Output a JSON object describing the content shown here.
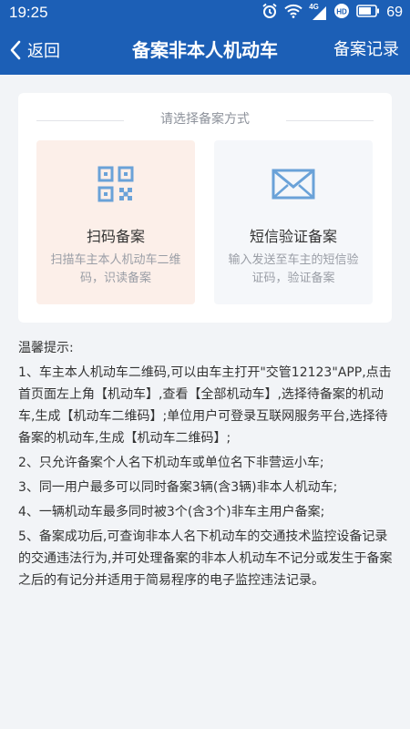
{
  "status": {
    "time": "19:25",
    "network": "4G",
    "battery": "69"
  },
  "nav": {
    "back_label": "返回",
    "title": "备案非本人机动车",
    "records_label": "备案记录"
  },
  "card": {
    "choose_label": "请选择备案方式",
    "options": [
      {
        "title": "扫码备案",
        "desc": "扫描车主本人机动车二维码，识读备案",
        "icon": "qrcode-icon"
      },
      {
        "title": "短信验证备案",
        "desc": "输入发送至车主的短信验证码，验证备案",
        "icon": "envelope-icon"
      }
    ]
  },
  "tips": {
    "heading": "温馨提示:",
    "items": [
      "1、车主本人机动车二维码,可以由车主打开\"交管12123\"APP,点击首页面左上角【机动车】,查看【全部机动车】,选择待备案的机动车,生成【机动车二维码】;单位用户可登录互联网服务平台,选择待备案的机动车,生成【机动车二维码】;",
      "2、只允许备案个人名下机动车或单位名下非营运小车;",
      "3、同一用户最多可以同时备案3辆(含3辆)非本人机动车;",
      "4、一辆机动车最多同时被3个(含3个)非车主用户备案;",
      "5、备案成功后,可查询非本人名下机动车的交通技术监控设备记录的交通违法行为,并可处理备案的非本人机动车不记分或发生于备案之后的有记分并适用于简易程序的电子监控违法记录。"
    ]
  },
  "colors": {
    "primary": "#1c5fb6",
    "icon_blue": "#6aa2d8"
  }
}
